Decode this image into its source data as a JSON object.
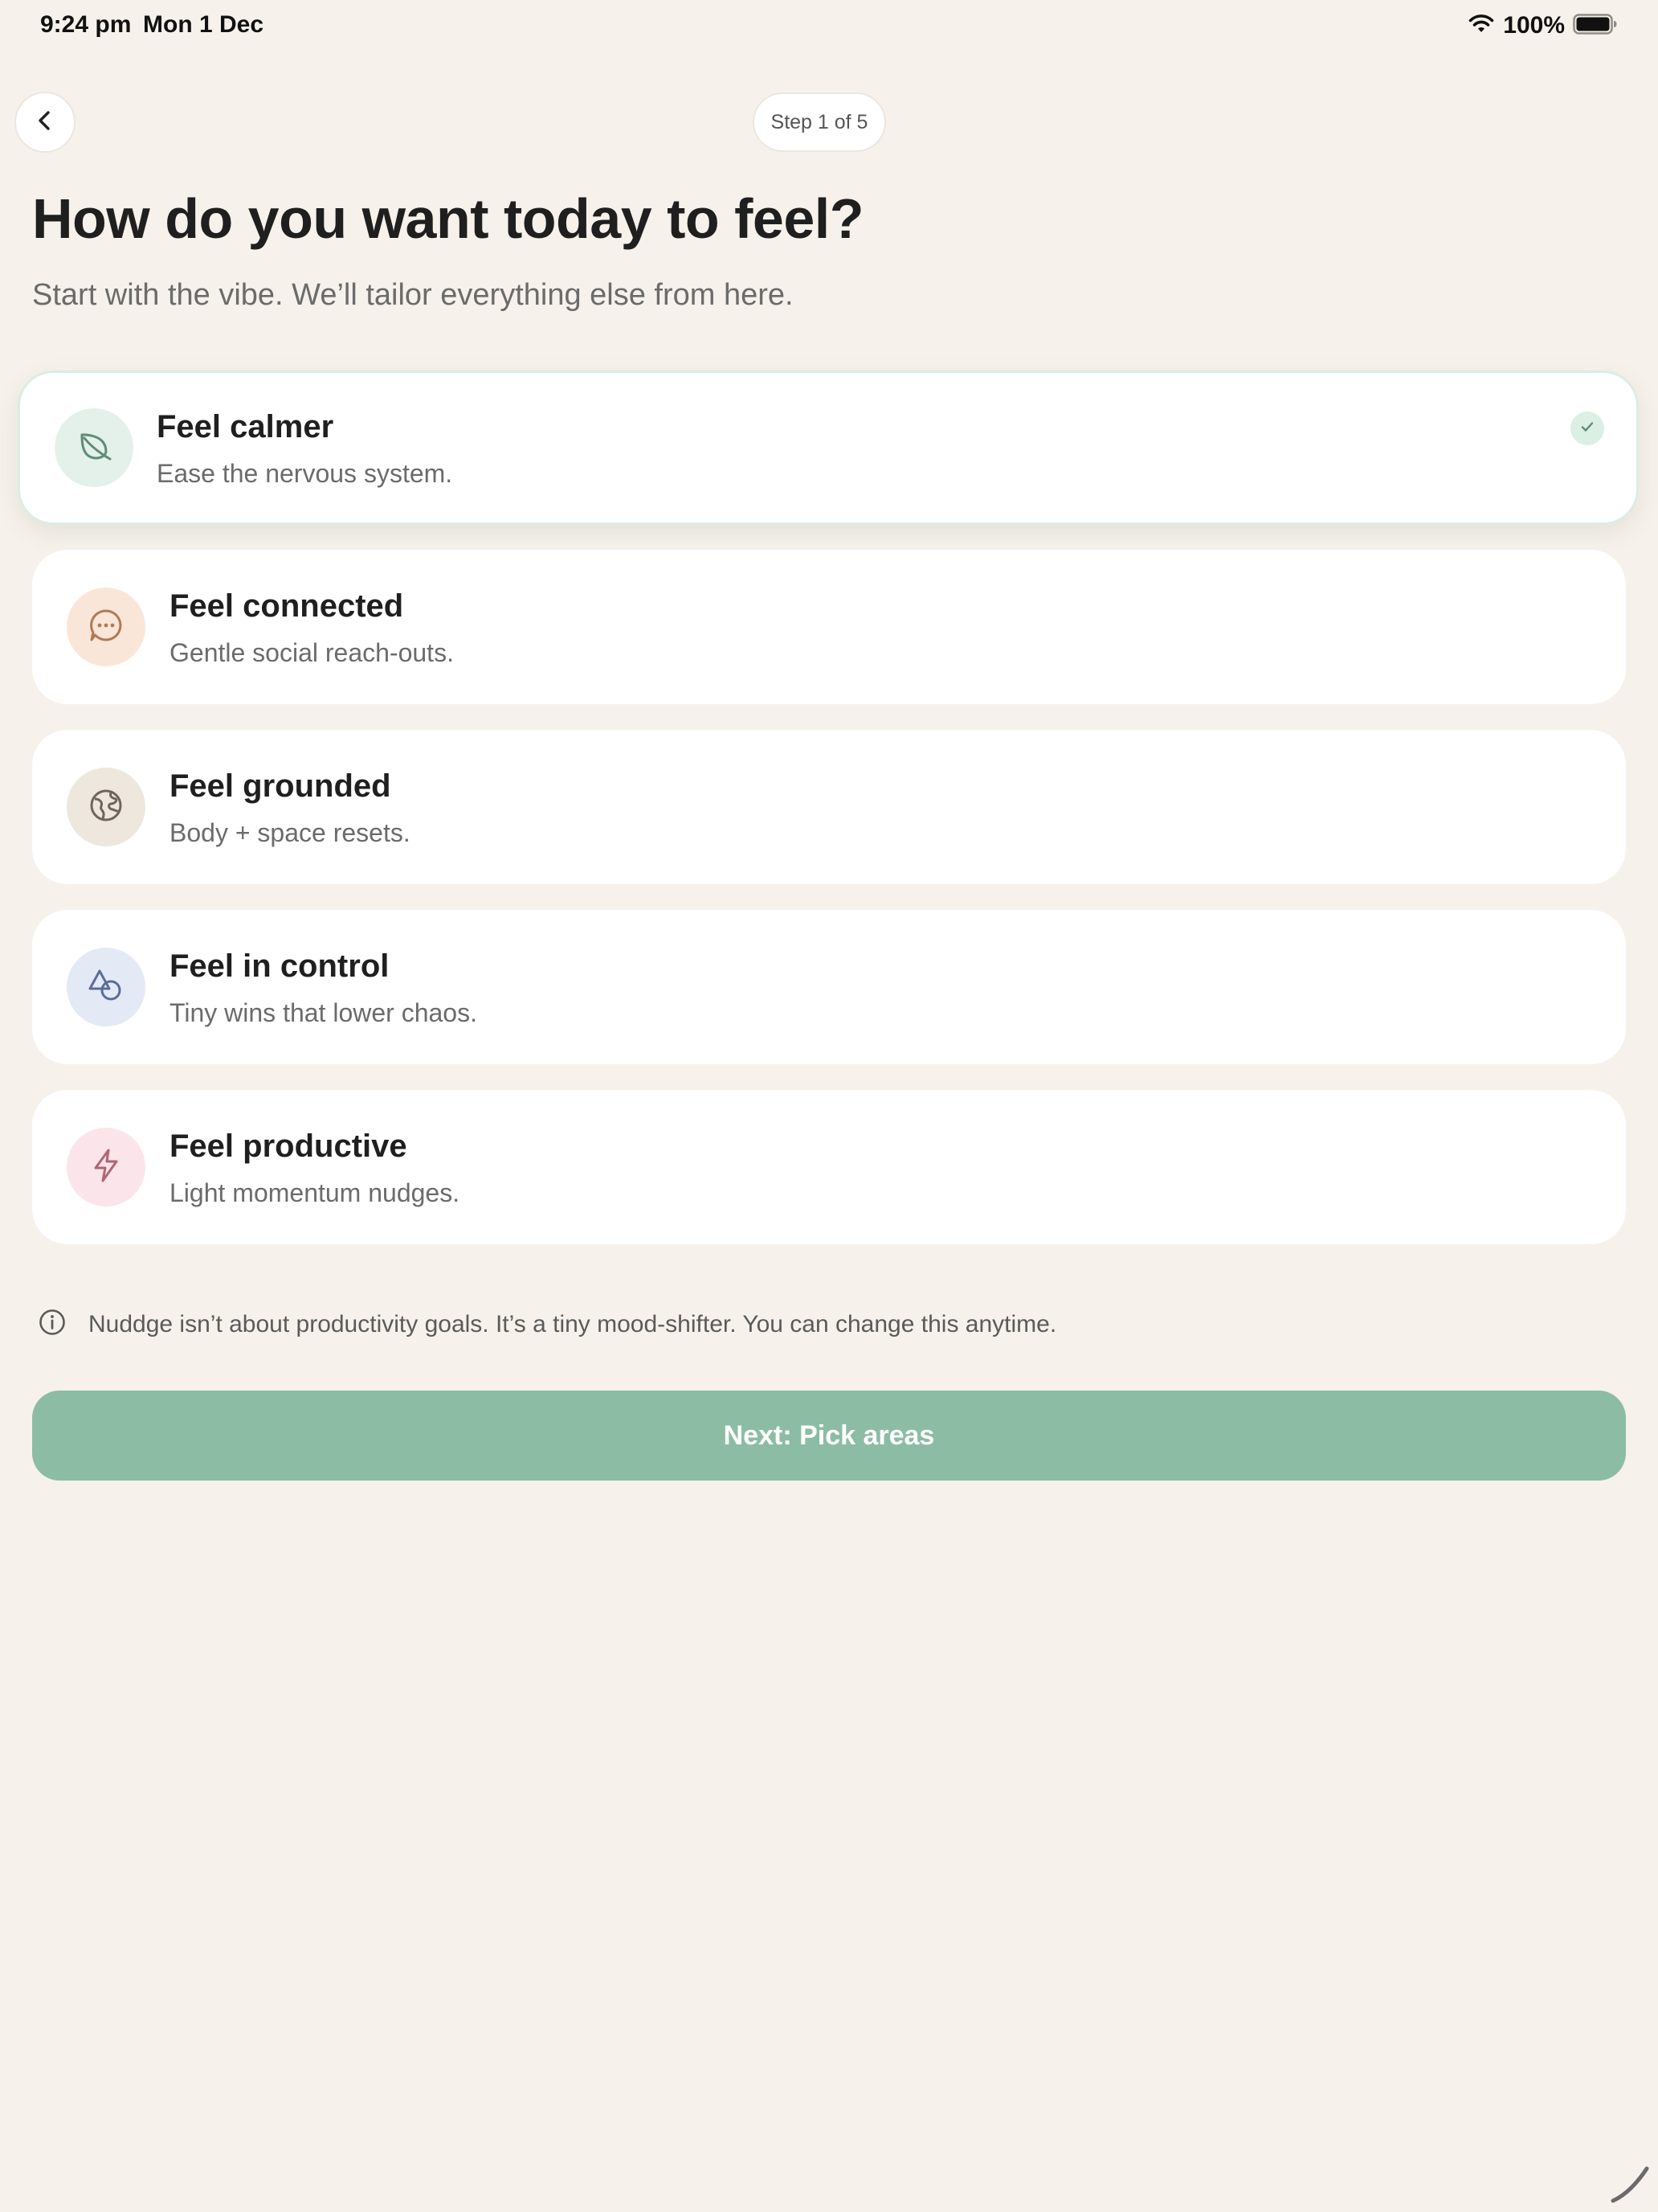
{
  "status_bar": {
    "time": "9:24 pm",
    "date": "Mon 1 Dec",
    "battery_percent": "100%",
    "battery_level": 1.0,
    "icons": [
      "wifi-icon",
      "battery-icon"
    ]
  },
  "header": {
    "back_icon": "chevron-left-icon",
    "step_label": "Step 1 of 5"
  },
  "main": {
    "title": "How do you want today to feel?",
    "subtitle": "Start with the vibe. We’ll tailor everything else from here.",
    "options": [
      {
        "title": "Feel calmer",
        "description": "Ease the nervous system.",
        "icon": "leaf-icon",
        "icon_bg": "#e3f1ea",
        "icon_color": "#5e8c74",
        "selected": true
      },
      {
        "title": "Feel connected",
        "description": "Gentle social reach-outs.",
        "icon": "chat-bubble-icon",
        "icon_bg": "#fae6d8",
        "icon_color": "#b07a52",
        "selected": false
      },
      {
        "title": "Feel grounded",
        "description": "Body + space resets.",
        "icon": "globe-icon",
        "icon_bg": "#ede7de",
        "icon_color": "#6f655a",
        "selected": false
      },
      {
        "title": "Feel in control",
        "description": "Tiny wins that lower chaos.",
        "icon": "shapes-icon",
        "icon_bg": "#e4e9f6",
        "icon_color": "#5a6d98",
        "selected": false
      },
      {
        "title": "Feel productive",
        "description": "Light momentum nudges.",
        "icon": "lightning-icon",
        "icon_bg": "#fbe4ea",
        "icon_color": "#b06575",
        "selected": false
      }
    ],
    "info_icon": "info-icon",
    "info_text": "Nuddge isn’t about productivity goals. It’s a tiny mood-shifter. You can change this anytime.",
    "next_button_label": "Next: Pick areas"
  },
  "colors": {
    "background": "#f6f2eb",
    "accent": "#8cbda4",
    "card": "#ffffff",
    "text_primary": "#1f1f1f",
    "text_secondary": "#6b6b6b"
  }
}
